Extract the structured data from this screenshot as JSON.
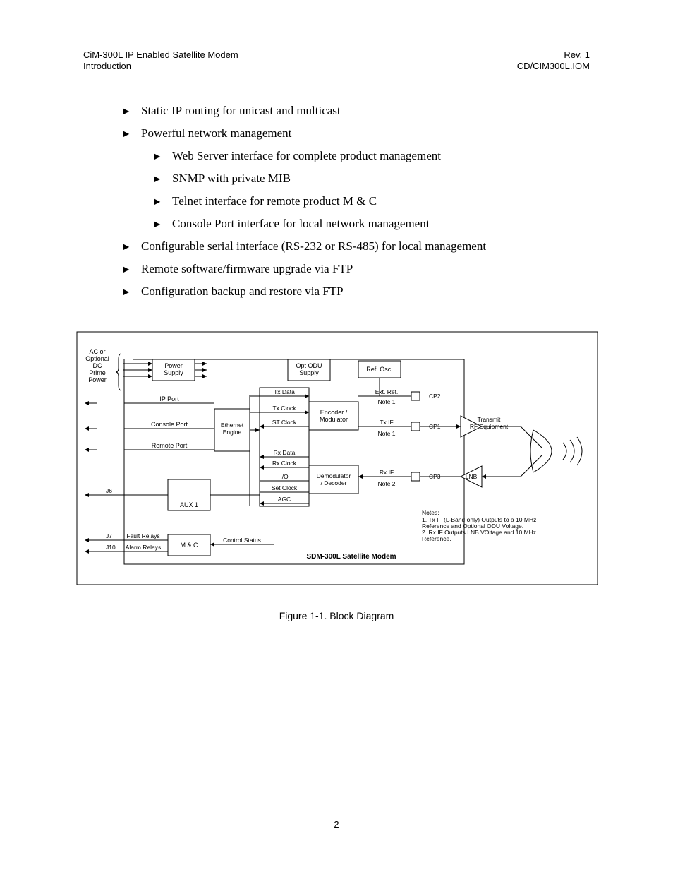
{
  "header": {
    "left_line1": "CiM-300L IP Enabled Satellite Modem",
    "left_line2": "Introduction",
    "right_line1": "Rev. 1",
    "right_line2": "CD/CIM300L.IOM"
  },
  "bullets": {
    "b1": "Static IP routing for unicast and multicast",
    "b2": "Powerful network management",
    "b2_1": "Web Server interface for complete product management",
    "b2_2": "SNMP with private MIB",
    "b2_3": "Telnet interface for remote product M & C",
    "b2_4": "Console Port interface for local network management",
    "b3": "Configurable serial interface (RS-232 or RS-485) for local management",
    "b4": "Remote software/firmware upgrade via FTP",
    "b5": "Configuration backup and restore via FTP"
  },
  "diagram": {
    "power_label_1": "AC or",
    "power_label_2": "Optional",
    "power_label_3": "DC",
    "power_label_4": "Prime",
    "power_label_5": "Power",
    "power_supply_1": "Power",
    "power_supply_2": "Supply",
    "odu_1": "Opt ODU",
    "odu_2": "Supply",
    "ref_osc": "Ref. Osc.",
    "ip_port": "IP Port",
    "console_port": "Console Port",
    "remote_port": "Remote Port",
    "ethernet_1": "Ethernet",
    "ethernet_2": "Engine",
    "tx_data": "Tx Data",
    "tx_clock": "Tx Clock",
    "st_clock": "ST Clock",
    "rx_data": "Rx Data",
    "rx_clock": "Rx Clock",
    "io": "I/O",
    "set_clock": "Set Clock",
    "agc": "AGC",
    "encoder_1": "Encoder /",
    "encoder_2": "Modulator",
    "demod_1": "Demodulator",
    "demod_2": "/ Decoder",
    "ext_ref": "Ext. Ref.",
    "note1": "Note 1",
    "note2": "Note 2",
    "tx_if": "Tx IF",
    "rx_if": "Rx IF",
    "cp1": "CP1",
    "cp2": "CP2",
    "cp3": "CP3",
    "transmit_1": "Transmit",
    "transmit_2": "RF Equipment",
    "lnb": "LNB",
    "aux1": "AUX 1",
    "j6": "J6",
    "j7": "J7",
    "j10": "J10",
    "fault_relays": "Fault Relays",
    "alarm_relays": "Alarm Relays",
    "mc": "M & C",
    "control_status": "Control Status",
    "notes_title": "Notes:",
    "notes_1a": "1. Tx IF (L-Band only) Outputs to a 10 MHz",
    "notes_1b": "    Reference and Optional ODU Voltage.",
    "notes_2a": "2. Rx IF Outputs LNB VOltage and 10 MHz",
    "notes_2b": "    Reference.",
    "title": "SDM-300L Satellite Modem"
  },
  "caption": "Figure 1-1.  Block Diagram",
  "page_number": "2"
}
